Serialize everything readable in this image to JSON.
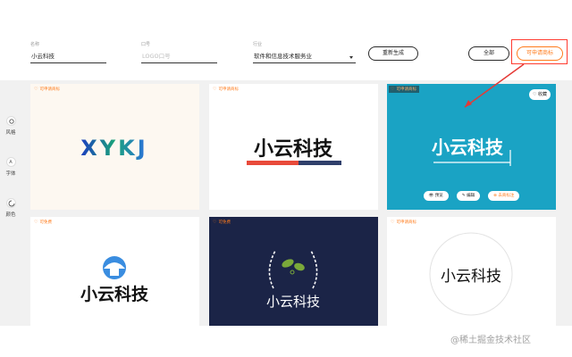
{
  "form": {
    "name": {
      "label": "名称",
      "value": "小云科技"
    },
    "slogan": {
      "label": "口号",
      "placeholder": "LOGO口号"
    },
    "industry": {
      "label": "行业",
      "value": "软件和信息技术服务业"
    },
    "regenerate_label": "重新生成",
    "all_label": "全部",
    "trademark_label": "可申请商标"
  },
  "sidebar": {
    "items": [
      {
        "label": "风格",
        "icon": "style-icon"
      },
      {
        "label": "字体",
        "icon": "font-icon",
        "glyph": "A"
      },
      {
        "label": "颜色",
        "icon": "palette-icon"
      }
    ]
  },
  "cards": [
    {
      "tag": "可申请商标",
      "brand": "XYKJ",
      "bg": "#fdf8f1"
    },
    {
      "tag": "可申请商标",
      "brand": "小云科技",
      "bg": "#ffffff"
    },
    {
      "tag": "可申请商标",
      "brand": "小云科技",
      "bg": "#1aa3c4",
      "fav_label": "收藏",
      "actions": [
        "预览",
        "编辑",
        "去商标注"
      ]
    },
    {
      "tag": "可免费",
      "brand": "小云科技",
      "bg": "#ffffff"
    },
    {
      "tag": "可免费",
      "brand": "小云科技",
      "bg": "#1b2447"
    },
    {
      "tag": "可申请商标",
      "brand": "小云科技",
      "bg": "#ffffff"
    }
  ],
  "watermark": "@稀土掘金技术社区",
  "colors": {
    "accent": "#ff7a1a",
    "highlight": "#ff3b30",
    "teal": "#1aa3c4",
    "navy": "#1b2447",
    "red_bar": "#e84a3a",
    "blue_bar": "#2f3f6b"
  }
}
